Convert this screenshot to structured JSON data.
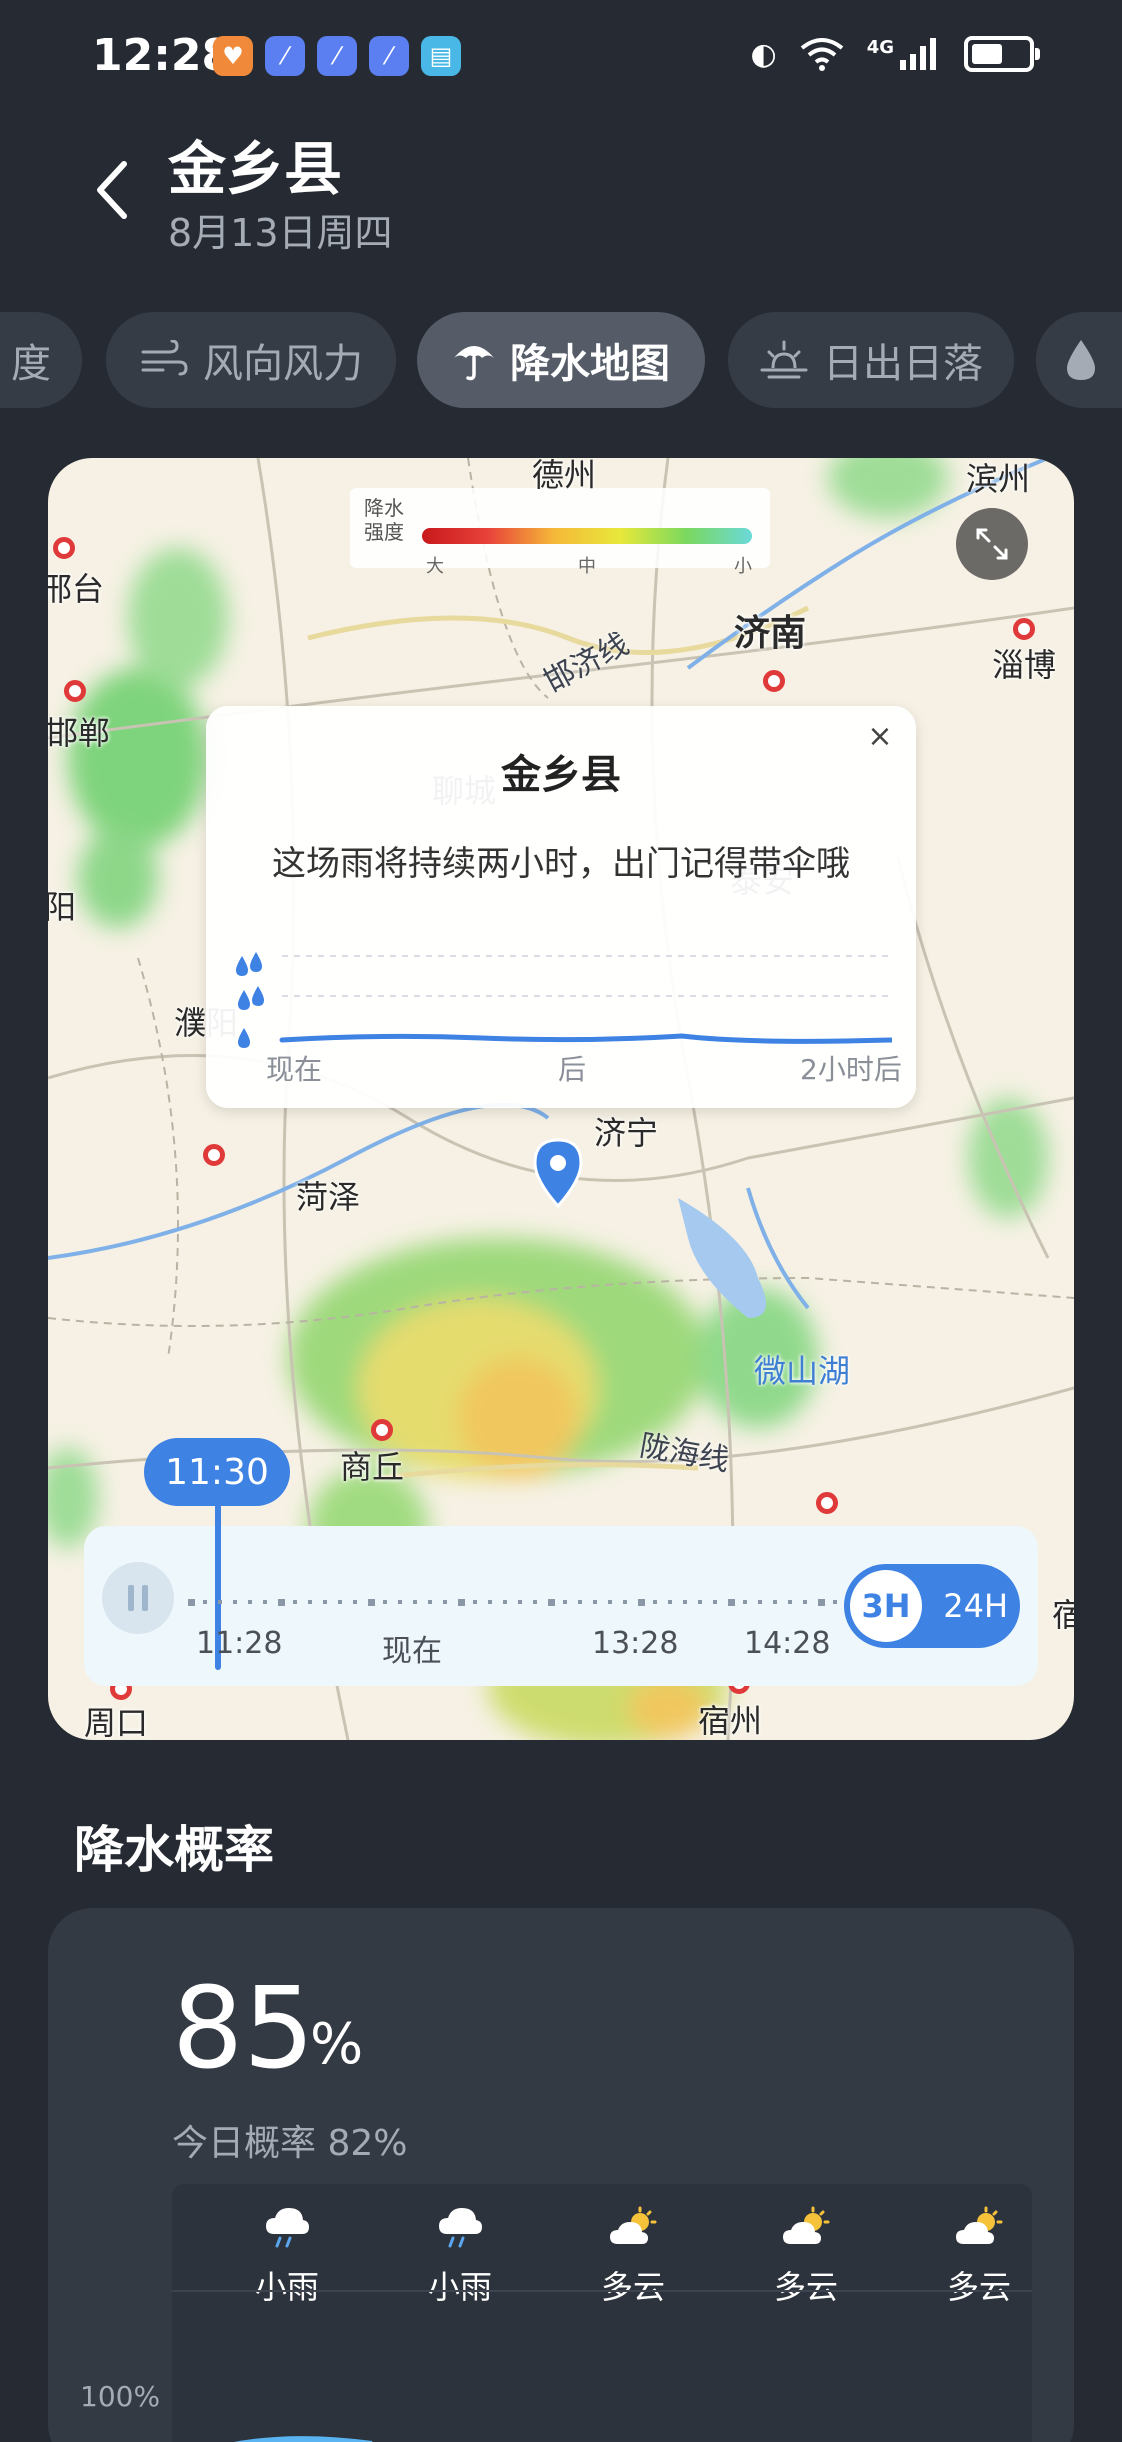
{
  "status": {
    "time": "12:28",
    "network": "4G",
    "battery_level": 0.55,
    "app_icons": [
      {
        "icon": "heart-app-icon",
        "color": "#f08a3a"
      },
      {
        "icon": "stripe-app-icon",
        "color": "#5b7ff0"
      },
      {
        "icon": "stripe-app-icon",
        "color": "#5b7ff0"
      },
      {
        "icon": "stripe-app-icon",
        "color": "#5b7ff0"
      },
      {
        "icon": "book-app-icon",
        "color": "#49b8e6"
      }
    ]
  },
  "header": {
    "title": "金乡县",
    "date": "8月13日周四"
  },
  "tabs": [
    {
      "label": "度",
      "icon": "",
      "active": false
    },
    {
      "label": "风向风力",
      "icon": "wind-icon",
      "active": false
    },
    {
      "label": "降水地图",
      "icon": "umbrella-icon",
      "active": true
    },
    {
      "label": "日出日落",
      "icon": "sunrise-icon",
      "active": false
    },
    {
      "label": "",
      "icon": "drop-icon",
      "active": false
    }
  ],
  "map": {
    "legend": {
      "title": "降水\n强度",
      "title_line1": "降水",
      "title_line2": "强度",
      "tick_high": "大",
      "tick_mid": "中",
      "tick_low": "小"
    },
    "places": {
      "dezhou": "德州",
      "binzhou": "滨州",
      "xingtai": "邢台",
      "jinan": "济南",
      "zibo": "淄博",
      "handan": "邯郸",
      "liaocheng": "聊城",
      "taian": "泰安",
      "anyang": "阳",
      "puyang": "濮阳",
      "jining": "济宁",
      "heze": "菏泽",
      "weishanhu": "微山湖",
      "shangqiu": "商丘",
      "suzhou": "宿州",
      "zhoukou": "周口",
      "su_right": "宿"
    },
    "roads": {
      "hanjixian": "邯济线",
      "longhaixian": "陇海线"
    },
    "popup": {
      "title": "金乡县",
      "message": "这场雨将持续两小时，出门记得带伞哦",
      "axis_start": "现在",
      "axis_mid": "后",
      "axis_end": "2小时后",
      "close": "×"
    },
    "timeline": {
      "current_time": "11:30",
      "ticks": [
        "11:28",
        "现在",
        "13:28",
        "14:28"
      ],
      "range_3h": "3H",
      "range_24h": "24H",
      "selected_range": "3H"
    }
  },
  "precip": {
    "section_title": "降水概率",
    "value": "85",
    "unit": "%",
    "today": "今日概率 82%",
    "y_label": "100%",
    "hourly": [
      {
        "label": "小雨",
        "icon": "light-rain-icon"
      },
      {
        "label": "小雨",
        "icon": "light-rain-icon"
      },
      {
        "label": "多云",
        "icon": "partly-cloudy-icon"
      },
      {
        "label": "多云",
        "icon": "partly-cloudy-icon"
      },
      {
        "label": "多云",
        "icon": "partly-cloudy-icon"
      }
    ]
  }
}
